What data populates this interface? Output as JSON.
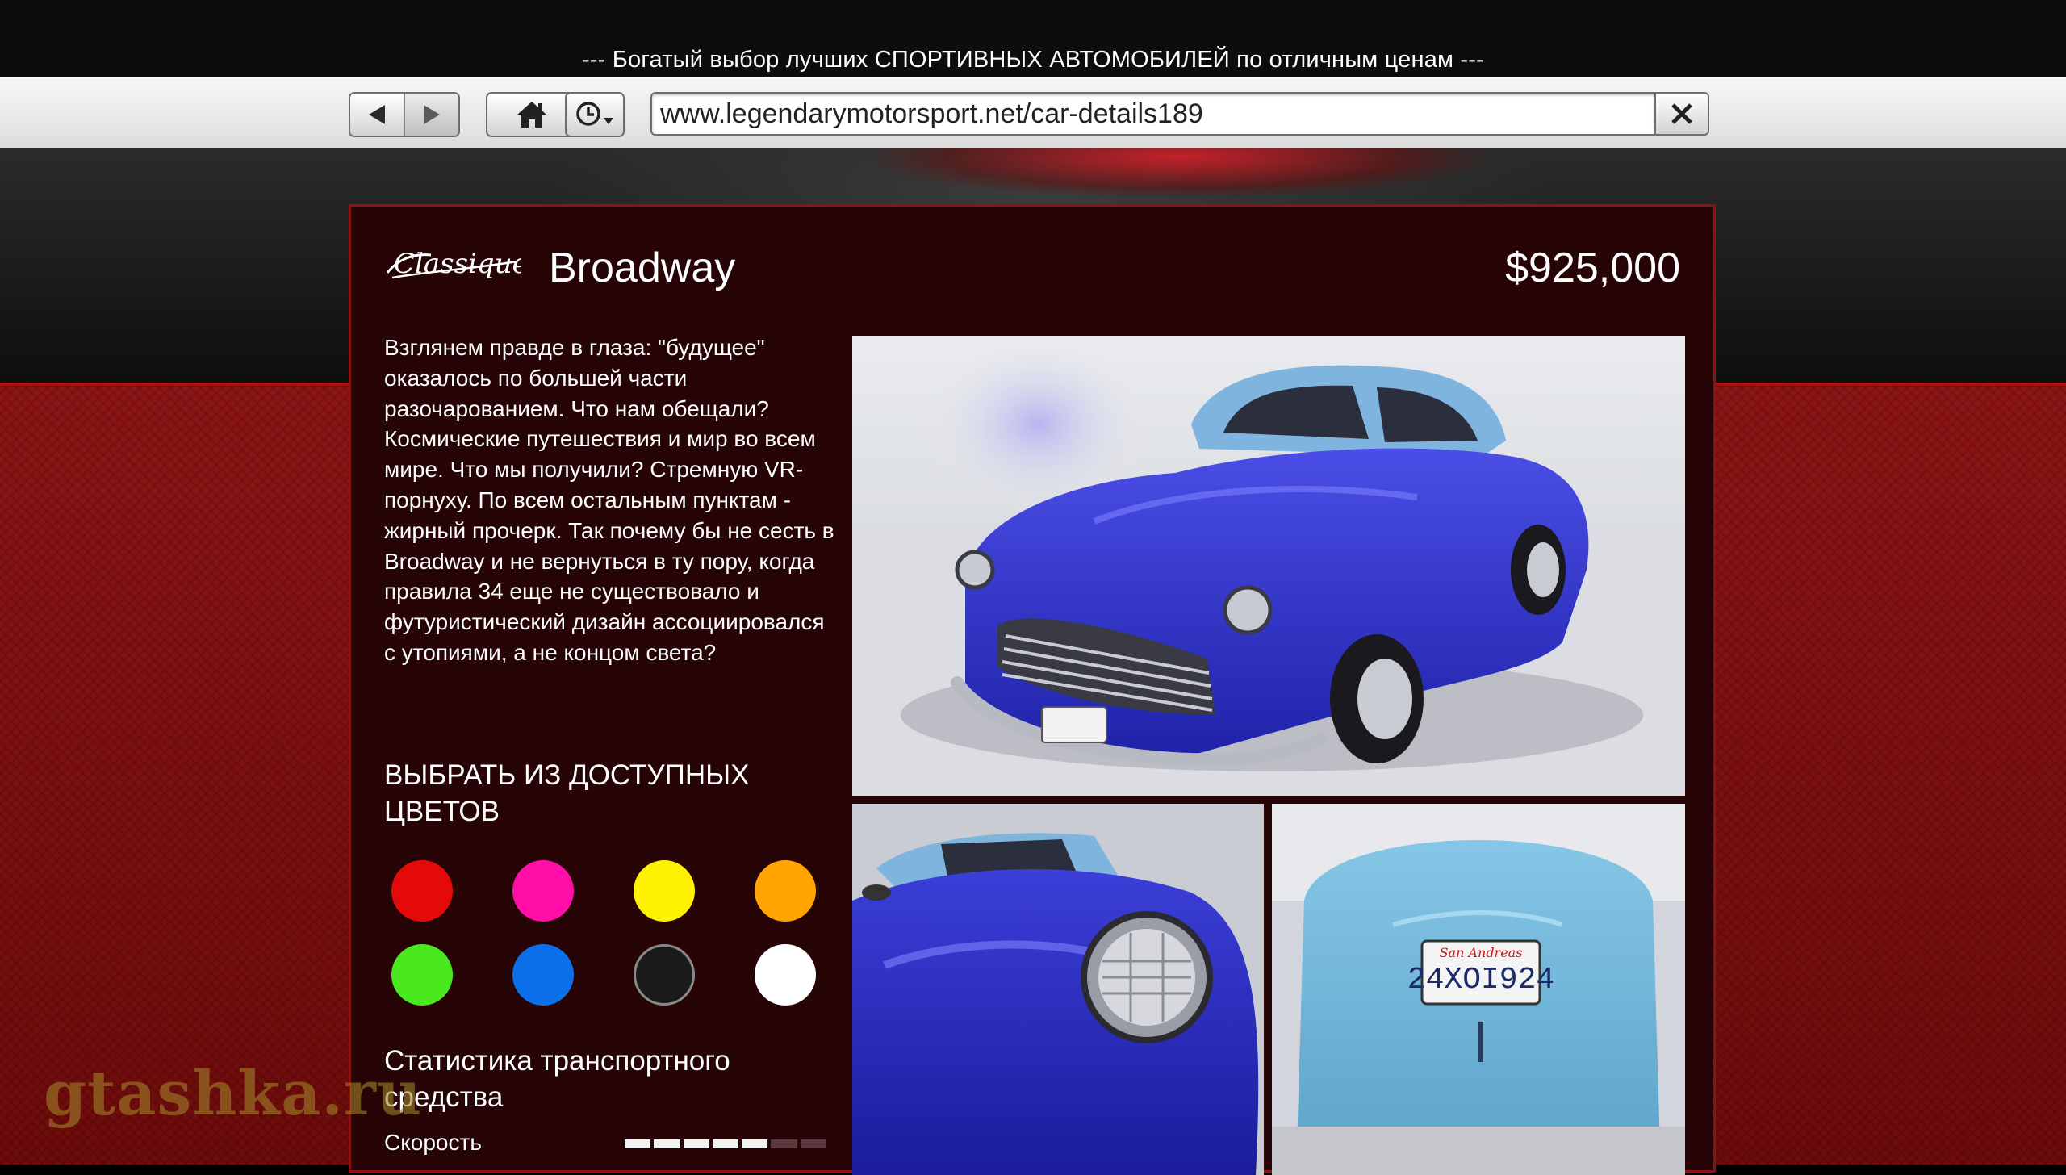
{
  "banner": {
    "text": "--- Богатый выбор лучших СПОРТИВНЫХ АВТОМОБИЛЕЙ по отличным ценам ---"
  },
  "browser": {
    "url": "www.legendarymotorsport.net/car-details189",
    "buttons": [
      "back-icon",
      "forward-icon",
      "home-icon",
      "history-icon",
      "close-icon"
    ]
  },
  "car": {
    "brand_logo_text": "Classique",
    "name": "Broadway",
    "price": "$925,000",
    "description": "Взглянем правде в глаза: \"будущее\" оказалось по большей части разочарованием. Что нам обещали? Космические путешествия и мир во всем мире. Что мы получили? Стремную VR-порнуху. По всем остальным пунктам - жирный прочерк. Так почему бы не сесть в Broadway и не вернуться в ту пору, когда правила 34 еще не существовало и футуристический дизайн ассоциировался с утопиями, а не концом света?"
  },
  "colors": {
    "heading": "ВЫБРАТЬ ИЗ ДОСТУПНЫХ ЦВЕТОВ",
    "swatches": [
      "#e50a0a",
      "#ff0fa8",
      "#fff200",
      "#ffa400",
      "#49e81f",
      "#0a6fe8",
      "#1a1a1a",
      "#ffffff"
    ]
  },
  "stats": {
    "heading": "Статистика транспортного средства",
    "speed_label": "Скорость",
    "speed_level": 0.65
  },
  "watermark": "gtashka.ru"
}
